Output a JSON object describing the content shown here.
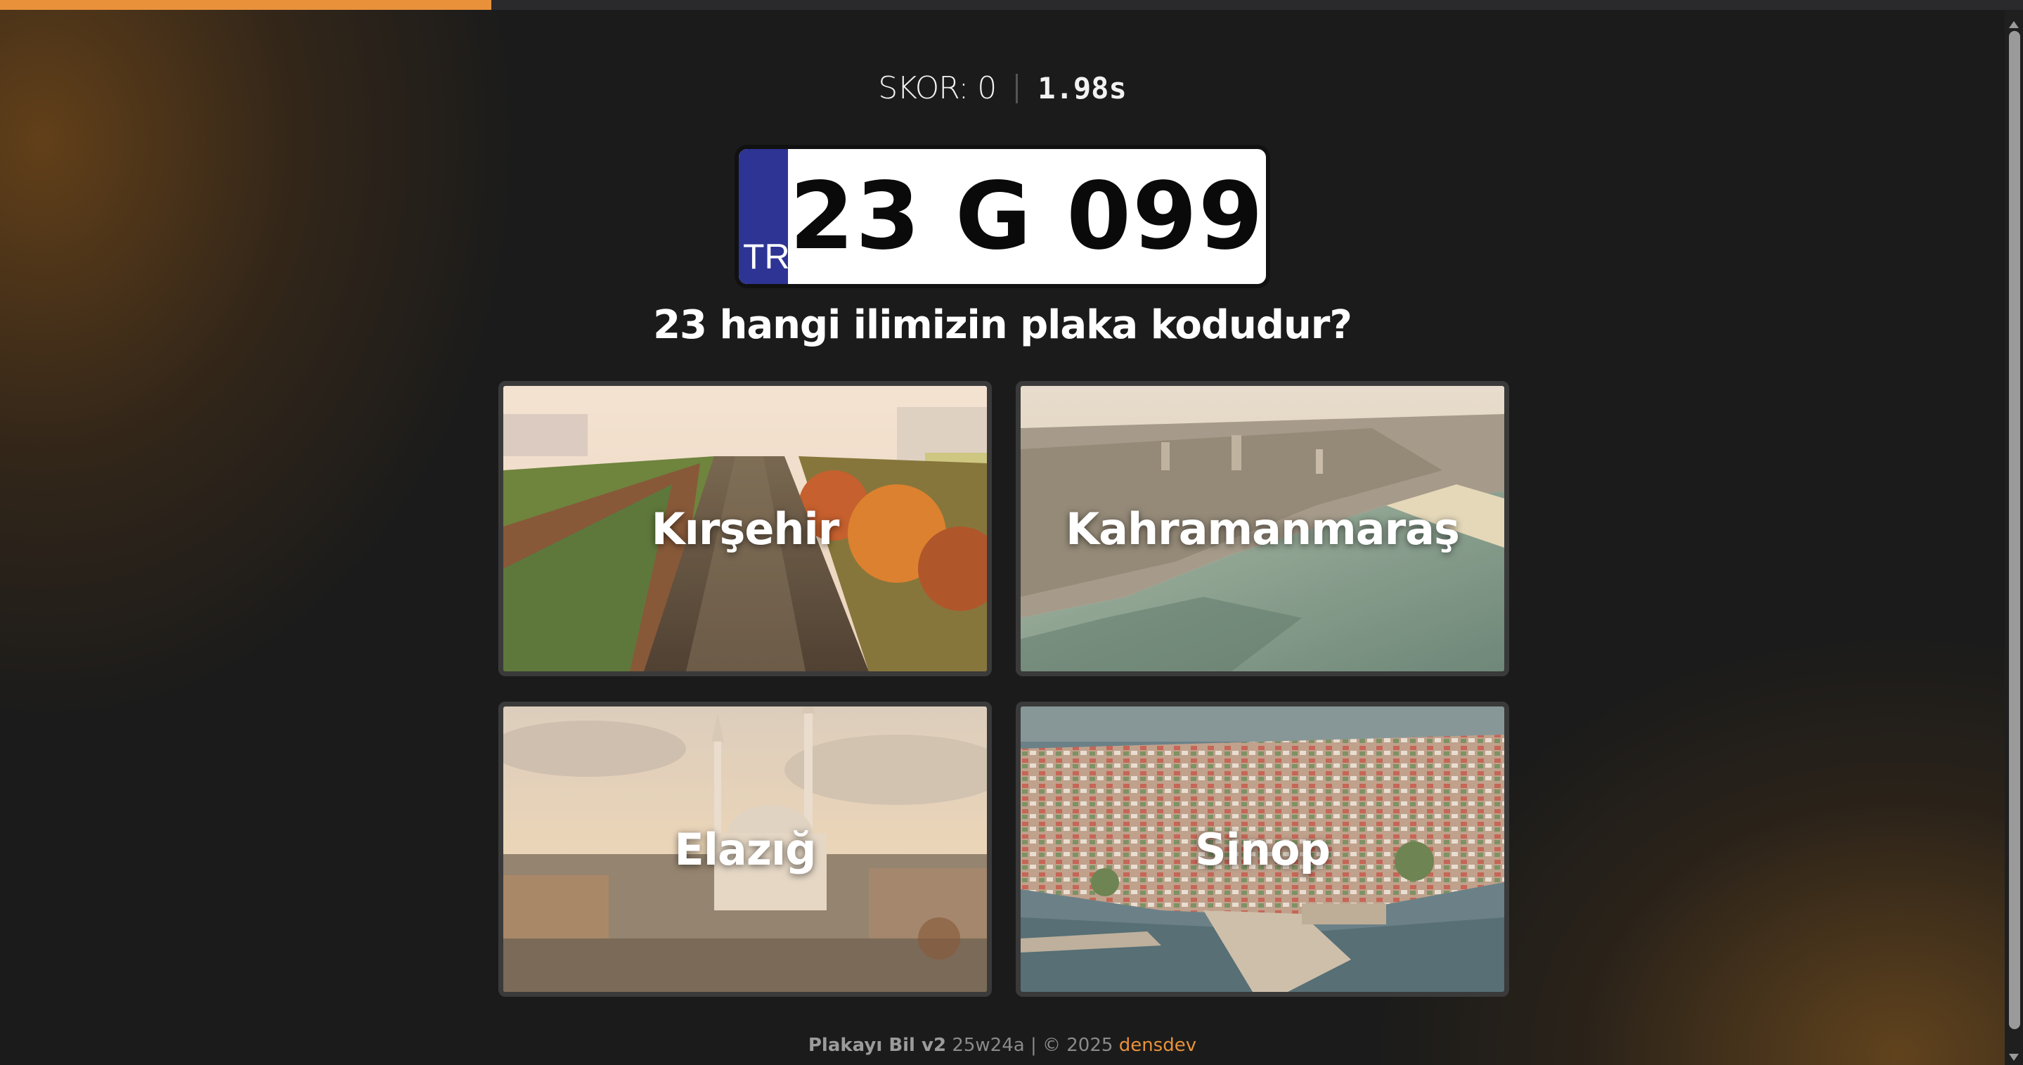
{
  "progress": {
    "fraction": 0.243,
    "color": "#e8913a"
  },
  "score": {
    "label": "SKOR: 0",
    "timer": "1.98s"
  },
  "plate": {
    "country": "TR",
    "number": "23 G 099"
  },
  "question": "23 hangi ilimizin plaka kodudur?",
  "options": [
    {
      "label": "Kırşehir",
      "scene": "canal-park"
    },
    {
      "label": "Kahramanmaraş",
      "scene": "coastal-city"
    },
    {
      "label": "Elazığ",
      "scene": "mosque-city"
    },
    {
      "label": "Sinop",
      "scene": "harbor-town"
    }
  ],
  "footer": {
    "brand": "Plakayı Bil v2",
    "version": "25w24a",
    "sep": " | © 2025 ",
    "author": "densdev"
  },
  "colors": {
    "accent": "#e8913a",
    "plate_band": "#2d3494",
    "background": "#1b1b1b"
  }
}
